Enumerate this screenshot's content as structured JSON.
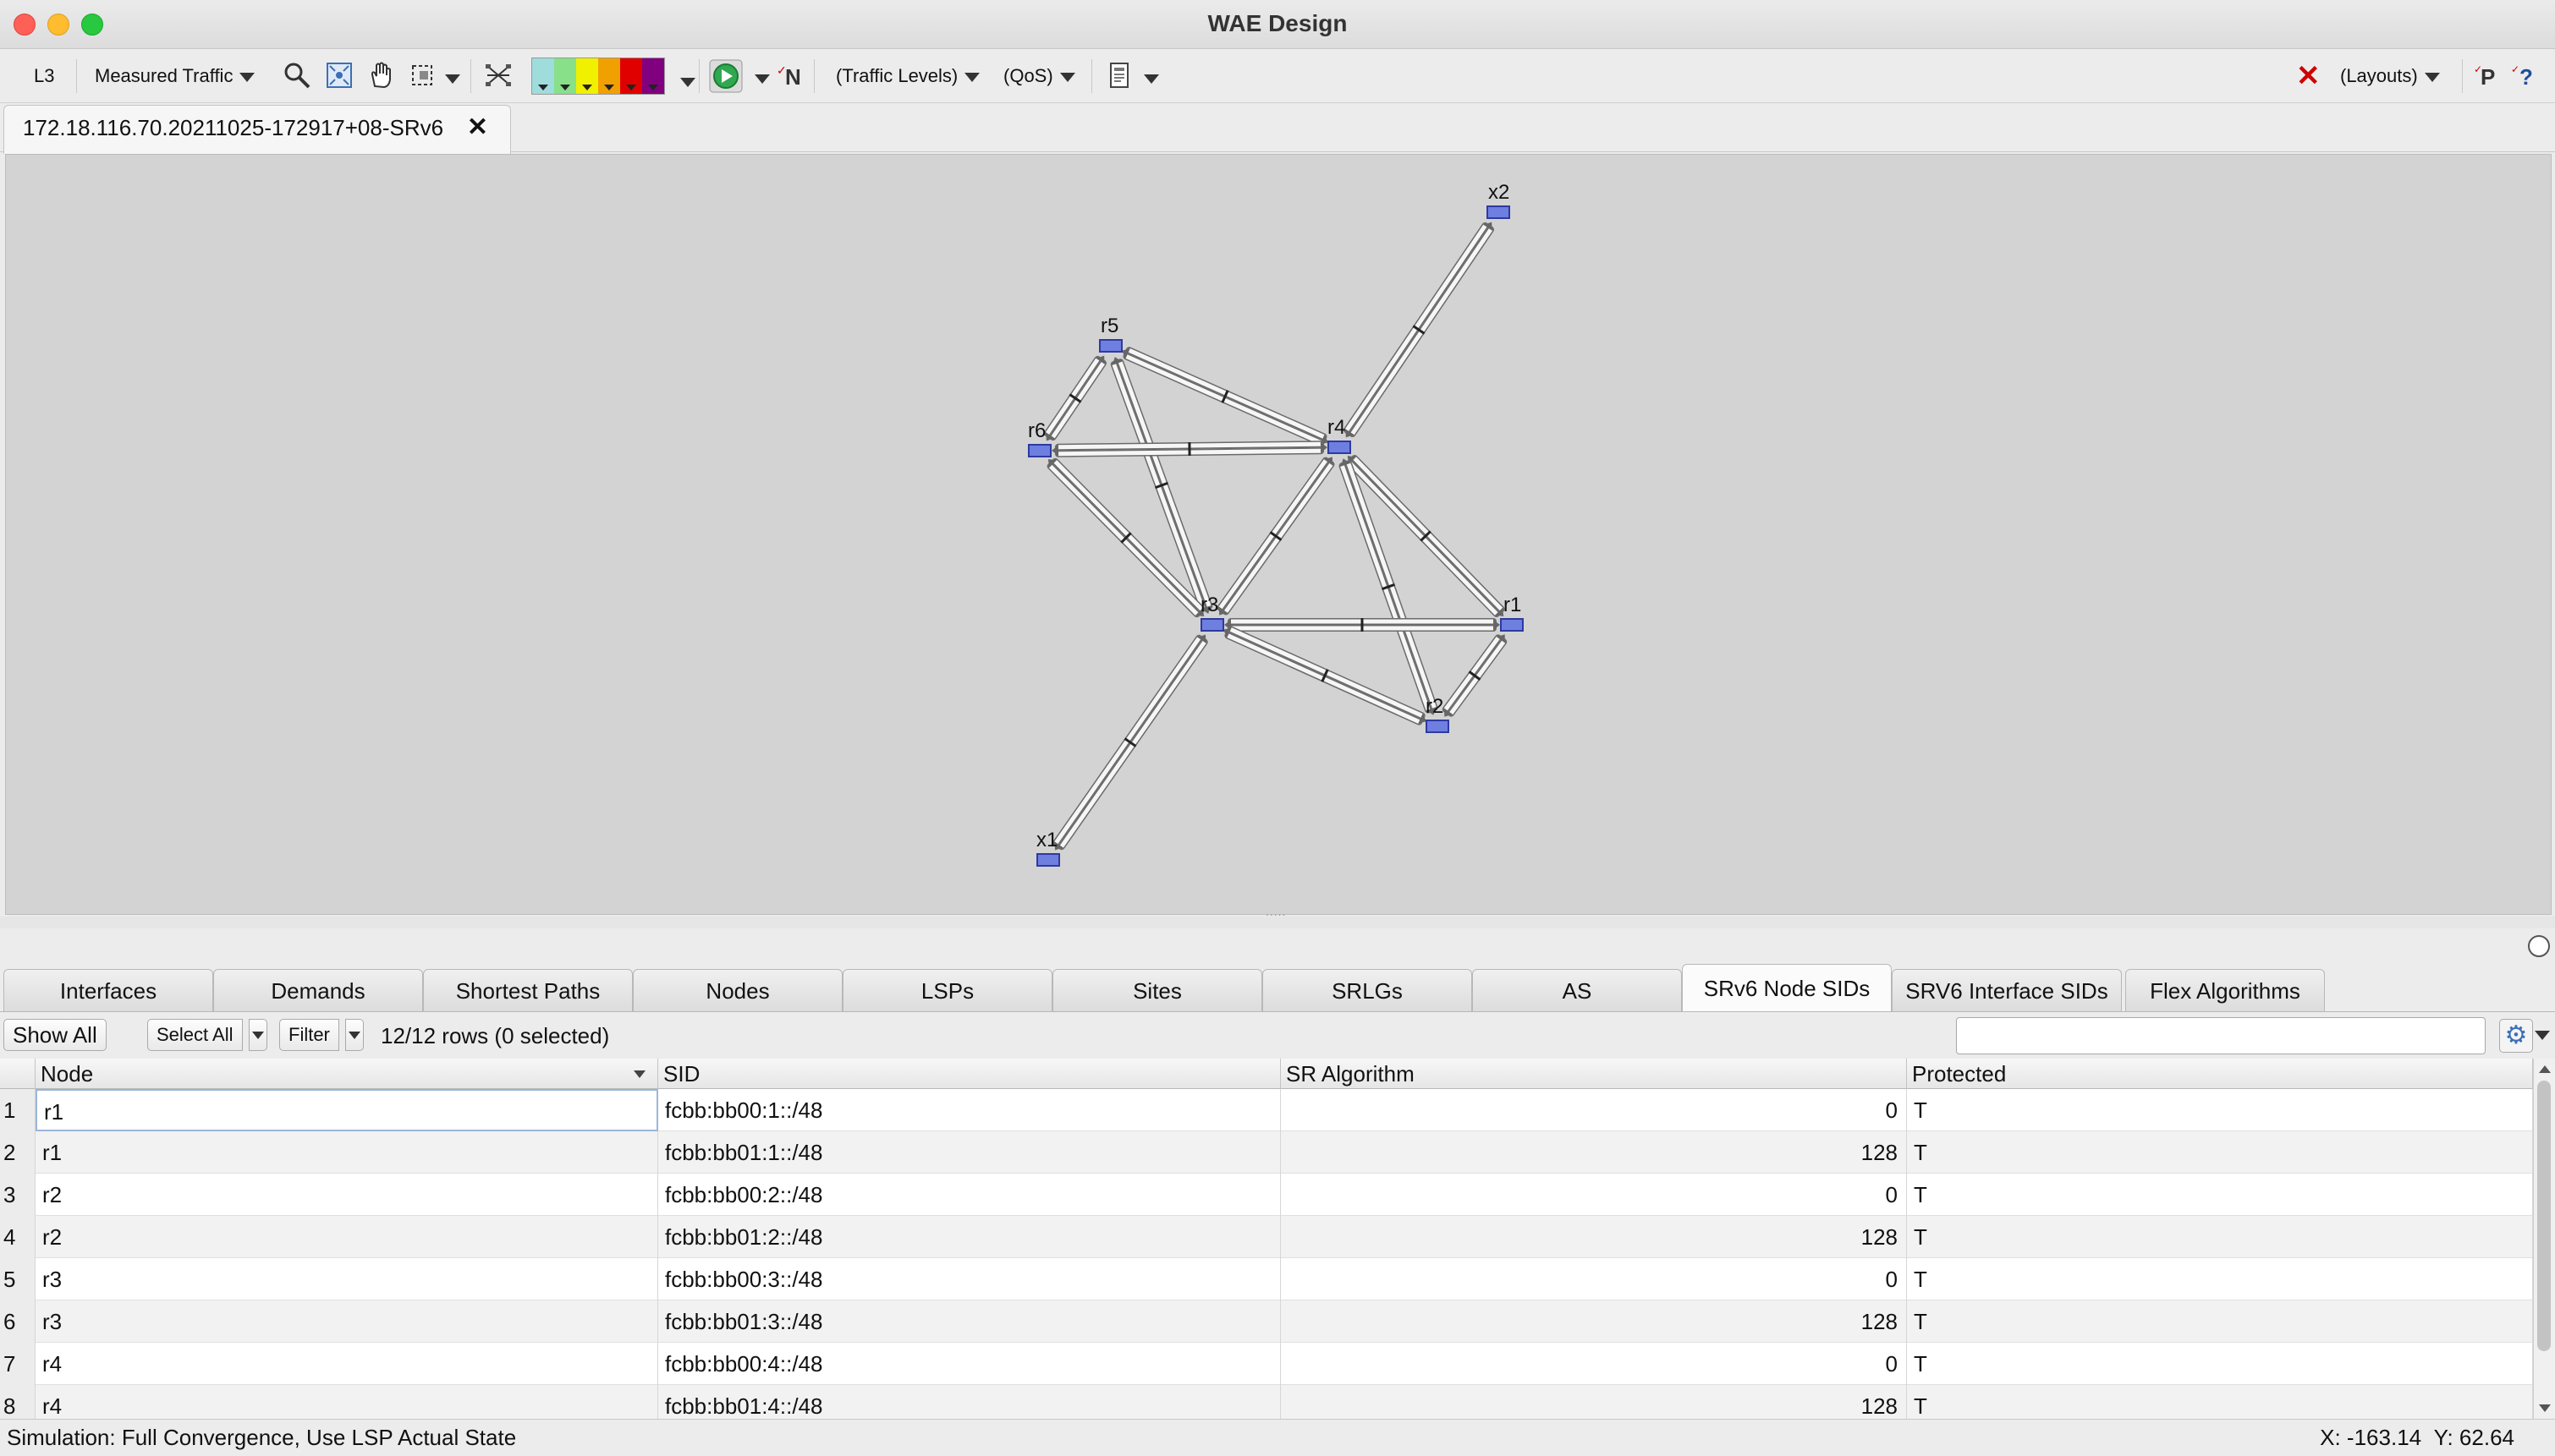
{
  "window": {
    "title": "WAE Design"
  },
  "toolbar": {
    "layer": "L3",
    "traffic_mode": "Measured Traffic",
    "traffic_levels": "(Traffic Levels)",
    "qos": "(QoS)",
    "layouts": "(Layouts)",
    "palette": [
      "#9fdcdc",
      "#88e088",
      "#f0f000",
      "#f0a000",
      "#e00000",
      "#800080"
    ]
  },
  "document": {
    "tab_title": "172.18.116.70.20211025-172917+08-SRv6"
  },
  "topology": {
    "nodes": [
      {
        "id": "x2",
        "label": "x2"
      },
      {
        "id": "r5",
        "label": "r5"
      },
      {
        "id": "r6",
        "label": "r6"
      },
      {
        "id": "r4",
        "label": "r4"
      },
      {
        "id": "r3",
        "label": "r3"
      },
      {
        "id": "r1",
        "label": "r1"
      },
      {
        "id": "r2",
        "label": "r2"
      },
      {
        "id": "x1",
        "label": "x1"
      }
    ],
    "links": [
      [
        "x2",
        "r4"
      ],
      [
        "r5",
        "r6"
      ],
      [
        "r5",
        "r4"
      ],
      [
        "r5",
        "r3"
      ],
      [
        "r6",
        "r4"
      ],
      [
        "r6",
        "r3"
      ],
      [
        "r4",
        "r3"
      ],
      [
        "r4",
        "r1"
      ],
      [
        "r4",
        "r2"
      ],
      [
        "r3",
        "r1"
      ],
      [
        "r3",
        "r2"
      ],
      [
        "r1",
        "r2"
      ],
      [
        "r3",
        "x1"
      ]
    ]
  },
  "tabs": [
    "Interfaces",
    "Demands",
    "Shortest Paths",
    "Nodes",
    "LSPs",
    "Sites",
    "SRLGs",
    "AS",
    "SRv6 Node SIDs",
    "SRV6 Interface SIDs",
    "Flex Algorithms"
  ],
  "active_tab": "SRv6 Node SIDs",
  "table_controls": {
    "show_all": "Show All",
    "select_all": "Select All",
    "filter": "Filter",
    "row_count": "12/12 rows (0 selected)",
    "search_value": ""
  },
  "table": {
    "columns": [
      "Node",
      "SID",
      "SR Algorithm",
      "Protected"
    ],
    "rows": [
      {
        "n": "1",
        "node": "r1",
        "sid": "fcbb:bb00:1::/48",
        "alg": "0",
        "prot": "T"
      },
      {
        "n": "2",
        "node": "r1",
        "sid": "fcbb:bb01:1::/48",
        "alg": "128",
        "prot": "T"
      },
      {
        "n": "3",
        "node": "r2",
        "sid": "fcbb:bb00:2::/48",
        "alg": "0",
        "prot": "T"
      },
      {
        "n": "4",
        "node": "r2",
        "sid": "fcbb:bb01:2::/48",
        "alg": "128",
        "prot": "T"
      },
      {
        "n": "5",
        "node": "r3",
        "sid": "fcbb:bb00:3::/48",
        "alg": "0",
        "prot": "T"
      },
      {
        "n": "6",
        "node": "r3",
        "sid": "fcbb:bb01:3::/48",
        "alg": "128",
        "prot": "T"
      },
      {
        "n": "7",
        "node": "r4",
        "sid": "fcbb:bb00:4::/48",
        "alg": "0",
        "prot": "T"
      },
      {
        "n": "8",
        "node": "r4",
        "sid": "fcbb:bb01:4::/48",
        "alg": "128",
        "prot": "T"
      }
    ]
  },
  "status": {
    "left": "Simulation: Full Convergence, Use LSP Actual State",
    "x_label": "X: -163.14",
    "y_label": "Y: 62.64"
  }
}
